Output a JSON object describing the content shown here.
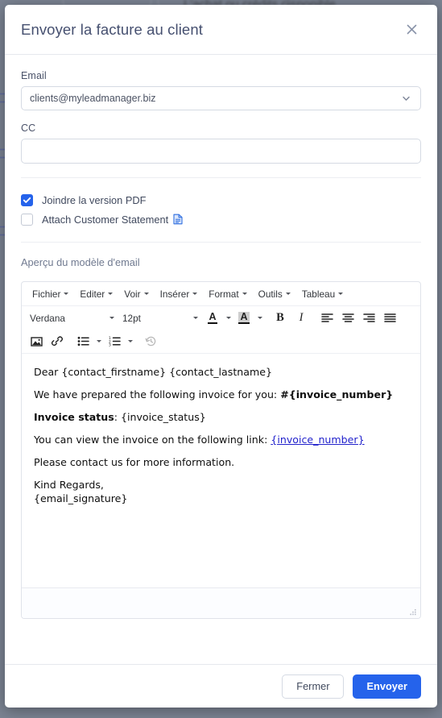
{
  "backdrop": {
    "obscured_text": "L'achat ou crédits disponible"
  },
  "modal": {
    "title": "Envoyer la facture au client",
    "close_icon": "close-icon",
    "fields": {
      "email": {
        "label": "Email",
        "value": "clients@myleadmanager.biz",
        "placeholder": "",
        "chevron_icon": "chevron-down-icon"
      },
      "cc": {
        "label": "CC",
        "value": "",
        "placeholder": ""
      }
    },
    "options": [
      {
        "label": "Joindre la version PDF",
        "checked": true,
        "has_doc_icon": false
      },
      {
        "label": "Attach Customer Statement",
        "checked": false,
        "has_doc_icon": true,
        "doc_icon": "document-icon"
      }
    ],
    "preview_label": "Aperçu du modèle d'email",
    "footer": {
      "close_label": "Fermer",
      "send_label": "Envoyer"
    }
  },
  "editor": {
    "menus": [
      "Fichier",
      "Editer",
      "Voir",
      "Insérer",
      "Format",
      "Outils",
      "Tableau"
    ],
    "font_name": "Verdana",
    "font_size": "12pt",
    "toolbar_icons": [
      "text-color-icon",
      "background-color-icon",
      "bold-icon",
      "italic-icon",
      "align-left-icon",
      "align-center-icon",
      "align-right-icon",
      "align-justify-icon",
      "image-icon",
      "link-icon",
      "bullet-list-icon",
      "numbered-list-icon",
      "restore-draft-icon"
    ],
    "body": {
      "greeting": "Dear {contact_firstname} {contact_lastname}",
      "line2_prefix": "We have prepared the following invoice for you: ",
      "line2_bold": "#{invoice_number}",
      "status_label": "Invoice status",
      "status_value": ": {invoice_status}",
      "link_prefix": "You can view the invoice on the following link: ",
      "link_text": "{invoice_number}",
      "contact_line": "Please contact us for more information.",
      "signoff": "Kind Regards,",
      "signature": "{email_signature}"
    },
    "resize_handle_icon": "resize-grip-icon"
  },
  "colors": {
    "accent": "#2563eb",
    "title_text": "#465070",
    "border": "#d5dae3",
    "link": "#2222cc",
    "backdrop": "#6c7585"
  }
}
